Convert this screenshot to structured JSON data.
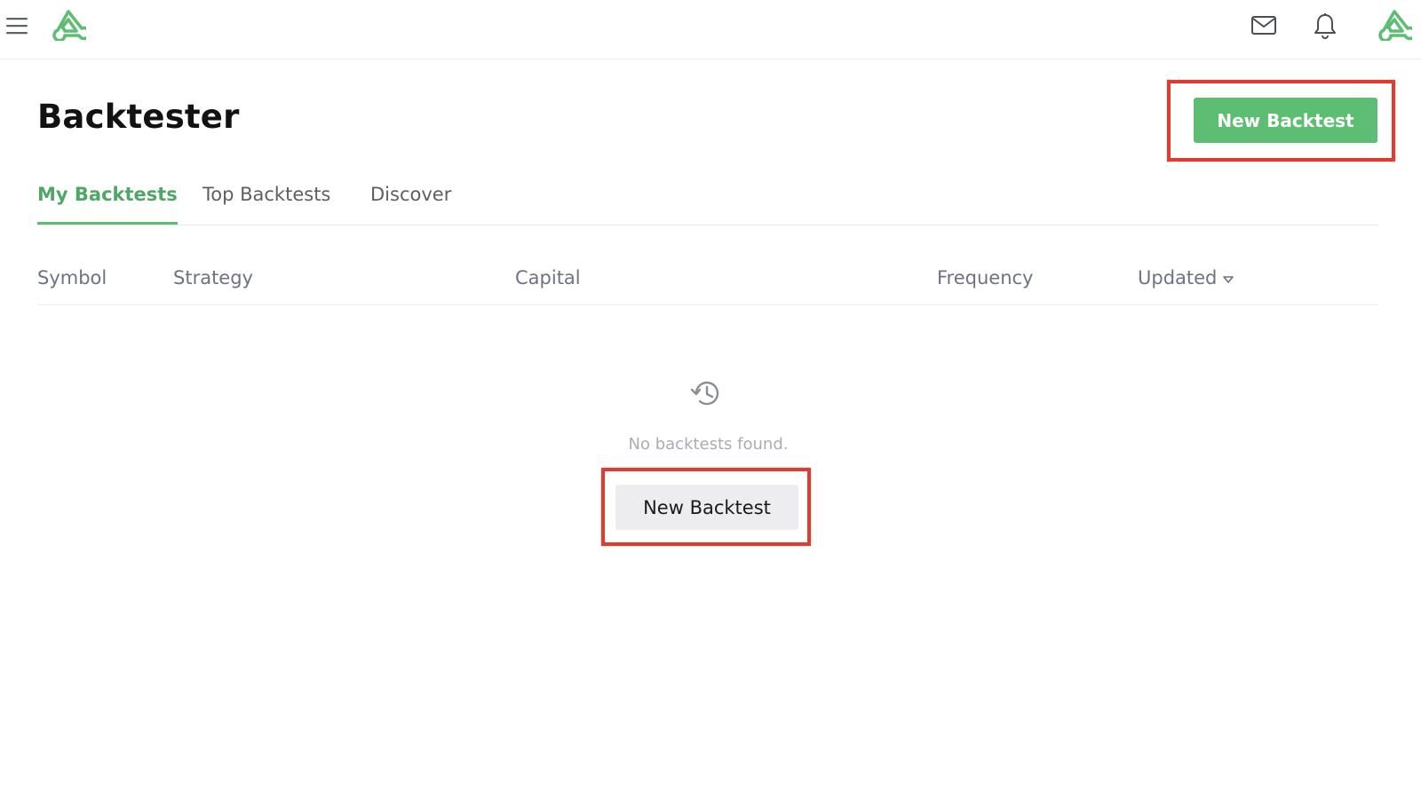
{
  "header": {
    "menu_icon": "hamburger-menu-icon",
    "logo_icon": "brand-logo-icon",
    "mail_icon": "mail-icon",
    "notifications_icon": "bell-icon",
    "avatar_icon": "user-avatar-logo-icon"
  },
  "page": {
    "title": "Backtester",
    "new_backtest_label": "New Backtest"
  },
  "tabs": [
    {
      "label": "My Backtests",
      "active": true
    },
    {
      "label": "Top Backtests",
      "active": false
    },
    {
      "label": "Discover",
      "active": false
    }
  ],
  "table": {
    "columns": [
      {
        "label": "Symbol"
      },
      {
        "label": "Strategy"
      },
      {
        "label": "Capital"
      },
      {
        "label": "Frequency"
      },
      {
        "label": "Updated",
        "sort": "descending"
      }
    ],
    "rows": []
  },
  "empty_state": {
    "icon": "history-icon",
    "message": "No backtests found.",
    "button_label": "New Backtest"
  },
  "colors": {
    "accent": "#5dbd72",
    "highlight": "#e03b2f"
  }
}
